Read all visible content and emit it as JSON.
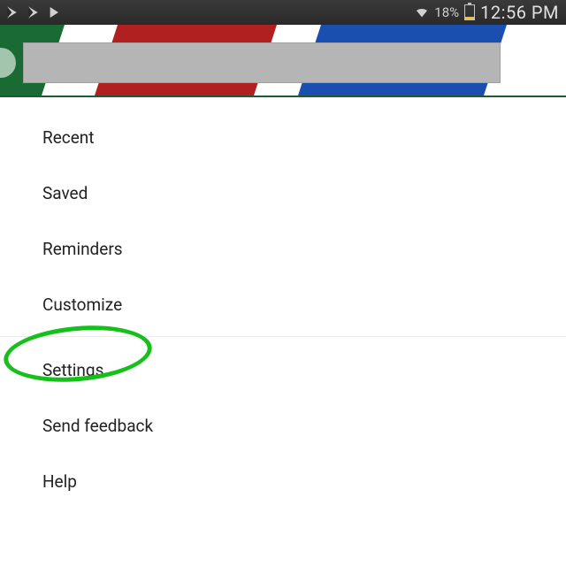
{
  "status_bar": {
    "battery_pct": "18%",
    "time": "12:56 PM"
  },
  "menu": {
    "items": [
      {
        "label": "Recent"
      },
      {
        "label": "Saved"
      },
      {
        "label": "Reminders"
      },
      {
        "label": "Customize"
      },
      {
        "label": "Settings"
      },
      {
        "label": "Send feedback"
      },
      {
        "label": "Help"
      }
    ],
    "highlighted_index": 4
  },
  "colors": {
    "highlight": "#16c01a",
    "header_green": "#1a6b33",
    "header_red": "#b02020",
    "header_blue": "#1a4fb0"
  }
}
